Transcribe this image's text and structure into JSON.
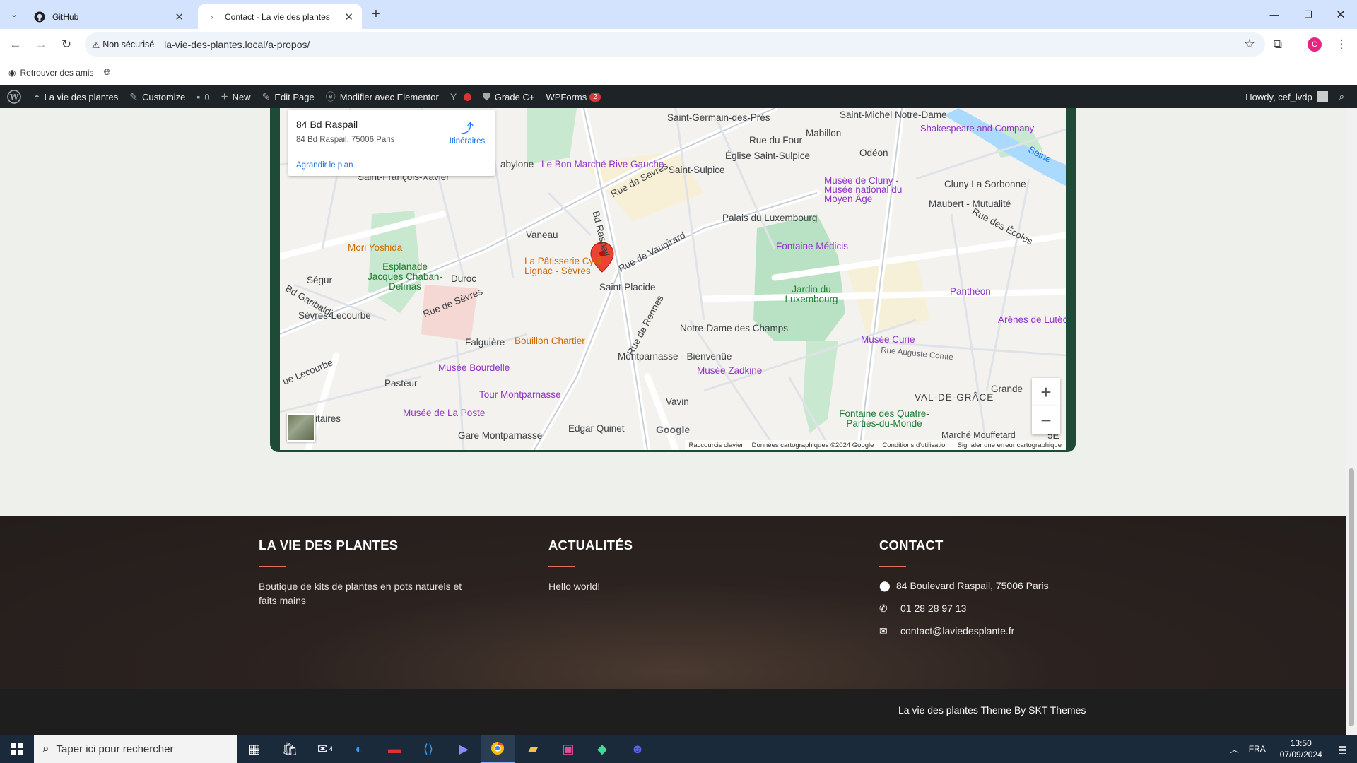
{
  "browser": {
    "tabs": [
      {
        "label": "GitHub",
        "icon": "github-icon"
      },
      {
        "label": "Contact - La vie des plantes",
        "icon": "loading-icon"
      }
    ],
    "security_label": "Non sécurisé",
    "url": "la-vie-des-plantes.local/a-propos/",
    "bookmark": "Retrouver des amis",
    "profile_initial": "C"
  },
  "adminbar": {
    "site": "La vie des plantes",
    "customize": "Customize",
    "comments": "0",
    "new": "New",
    "edit": "Edit Page",
    "elementor": "Modifier avec Elementor",
    "grade": "Grade C+",
    "wpforms": "WPForms",
    "wpforms_count": "2",
    "howdy": "Howdy, cef_lvdp"
  },
  "map": {
    "place_title": "84 Bd Raspail",
    "place_address": "84 Bd Raspail, 75006 Paris",
    "directions": "Itinéraires",
    "enlarge": "Agrandir le plan",
    "zoom_in": "+",
    "zoom_out": "−",
    "google": "Google",
    "footer_links": [
      "Raccourcis clavier",
      "Données cartographiques ©2024 Google",
      "Conditions d'utilisation",
      "Signaler une erreur cartographique"
    ],
    "labels": {
      "saint_germain": "Saint-Germain-des-Prés",
      "saint_michel": "Saint-Michel Notre-Dame",
      "shakespeare": "Shakespeare and Company",
      "rue_du_four": "Rue du Four",
      "mabillon": "Mabillon",
      "bon_marche": "Le Bon Marché Rive Gauche",
      "eglise": "Église Saint-Sulpice",
      "odeon": "Odéon",
      "saint_sulpice": "Saint-Sulpice",
      "cluny_musee": "Musée de Cluny - Musée national du Moyen Âge",
      "cluny_sorbonne": "Cluny La Sorbonne",
      "maubert": "Maubert - Mutualité",
      "babylone": "abylone",
      "saint_francois": "Saint-François-Xavier",
      "rue_des_ecoles": "Rue des Écoles",
      "palais_lux": "Palais du Luxembourg",
      "vaneau": "Vaneau",
      "mori": "Mori Yoshida",
      "patisserie": "La Pâtisserie Cyril Lignac - Sèvres",
      "fontaine_medicis": "Fontaine Médicis",
      "rue_vaugirard": "Rue de Vaugirard",
      "esplanade": "Esplanade Jacques Chaban-Delmas",
      "segur": "Ségur",
      "duroc": "Duroc",
      "saint_placide": "Saint-Placide",
      "jardin_lux": "Jardin du Luxembourg",
      "pantheon": "Panthéon",
      "sevres_lecourbe": "Sèvres-Lecourbe",
      "arenes": "Arènes de Lutèce",
      "notre_dame_champs": "Notre-Dame des Champs",
      "falguiere": "Falguière",
      "bouillon": "Bouillon Chartier",
      "montparnasse": "Montparnasse - Bienvenüe",
      "musee_curie": "Musée Curie",
      "musee_bourdelle": "Musée Bourdelle",
      "musee_zadkine": "Musée Zadkine",
      "pasteur": "Pasteur",
      "tour_montparnasse": "Tour Montparnasse",
      "val_de_grace": "VAL-DE-GRÂCE",
      "vavin": "Vavin",
      "musee_poste": "Musée de La Poste",
      "fontaine_quatre": "Fontaine des Quatre-Parties-du-Monde",
      "edgar_quinet": "Edgar Quinet",
      "gare_montparnasse": "Gare Montparnasse",
      "marche_mouffetard": "Marché Mouffetard",
      "volontaires": "itaires",
      "grande": "Grande",
      "bd_raspail": "Bd Raspail",
      "rue_de_sevres": "Rue de Sèvres",
      "rue_de_rennes": "Rue de Rennes",
      "bd_garibaldi": "Bd Garibaldi",
      "rue_lecourbe": "ue Lecourbe",
      "rue_auguste_comte": "Rue Auguste Comte",
      "seine": "Seine",
      "zone": "5E"
    }
  },
  "footer": {
    "col1_title": "LA VIE DES PLANTES",
    "col1_text": "Boutique de kits de plantes en pots naturels et faits mains",
    "col2_title": "ACTUALITÉS",
    "col2_text": "Hello world!",
    "col3_title": "CONTACT",
    "address": "84 Boulevard Raspail, 75006 Paris",
    "phone": "01 28 28 97 13",
    "email": "contact@laviedesplante.fr",
    "credit": "La vie des plantes Theme By SKT Themes"
  },
  "taskbar": {
    "search_placeholder": "Taper ici pour rechercher",
    "lang": "FRA",
    "time": "13:50",
    "date": "07/09/2024",
    "mail_badge": "4"
  },
  "colors": {
    "accent_footer_bar": "#e46f5c",
    "map_frame": "#1e4a38",
    "adminbar": "#1d2327",
    "chrome_tabbar": "#d3e3fd"
  }
}
